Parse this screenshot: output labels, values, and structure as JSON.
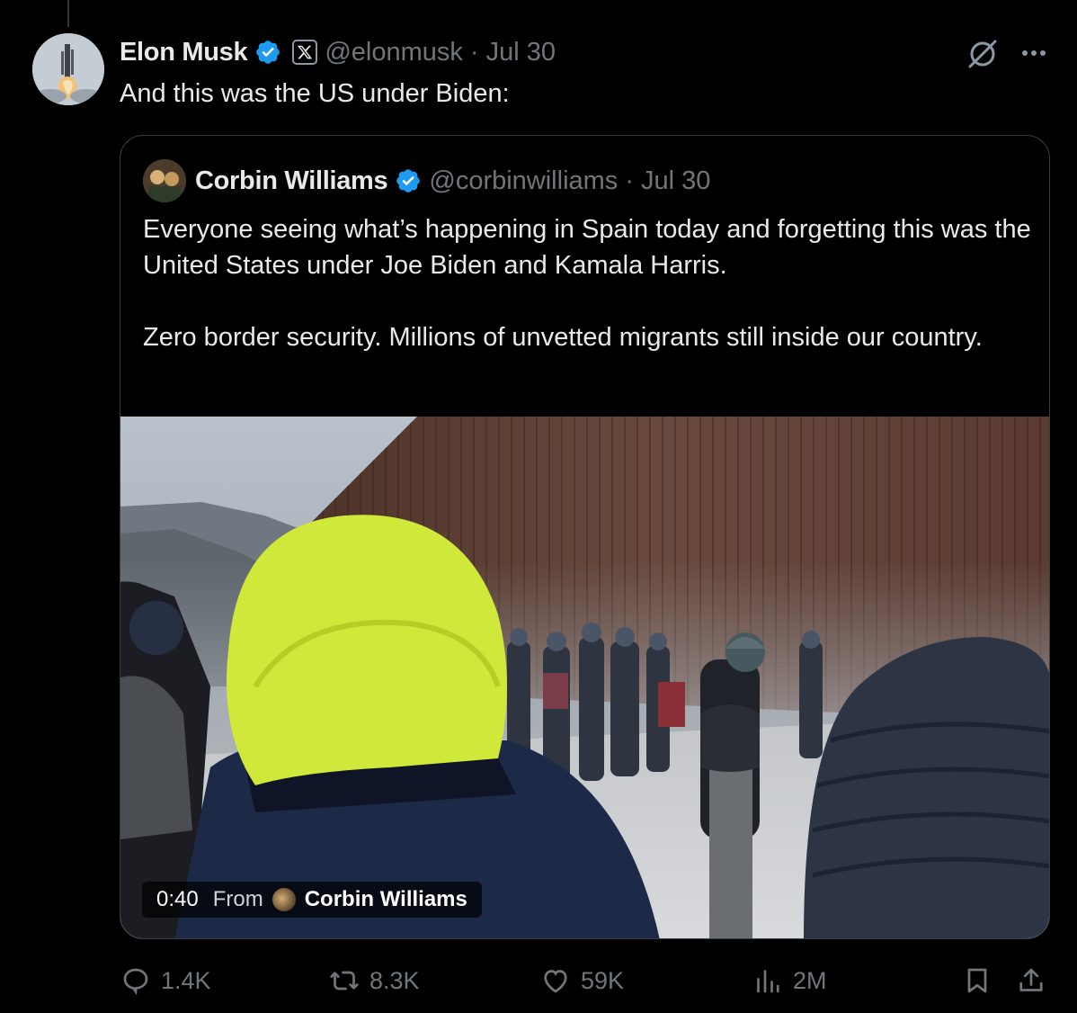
{
  "post": {
    "author_name": "Elon Musk",
    "handle": "@elonmusk",
    "separator": "·",
    "date": "Jul 30",
    "text": "And this was the US under Biden:"
  },
  "quoted": {
    "author_name": "Corbin Williams",
    "handle": "@corbinwilliams",
    "separator": "·",
    "date": "Jul 30",
    "paragraphs": [
      "Everyone seeing what’s happening in Spain today and forgetting this was the United States under Joe Biden and Kamala Harris.",
      "Zero border security. Millions of unvetted migrants still inside our country."
    ],
    "video": {
      "duration": "0:40",
      "from_label": "From",
      "from_name": "Corbin Williams"
    }
  },
  "actions": {
    "replies": "1.4K",
    "reposts": "8.3K",
    "likes": "59K",
    "views": "2M"
  },
  "icons": {
    "verified": "verified-badge-icon",
    "affiliate": "x-logo-icon",
    "grok": "grok-icon",
    "more": "more-icon",
    "reply": "reply-icon",
    "repost": "repost-icon",
    "like": "heart-icon",
    "views": "views-icon",
    "bookmark": "bookmark-icon",
    "share": "share-icon"
  },
  "colors": {
    "background": "#000000",
    "text": "#e7e9ea",
    "muted": "#71767b",
    "verified": "#1d9bf0",
    "border": "#3a3e42"
  }
}
